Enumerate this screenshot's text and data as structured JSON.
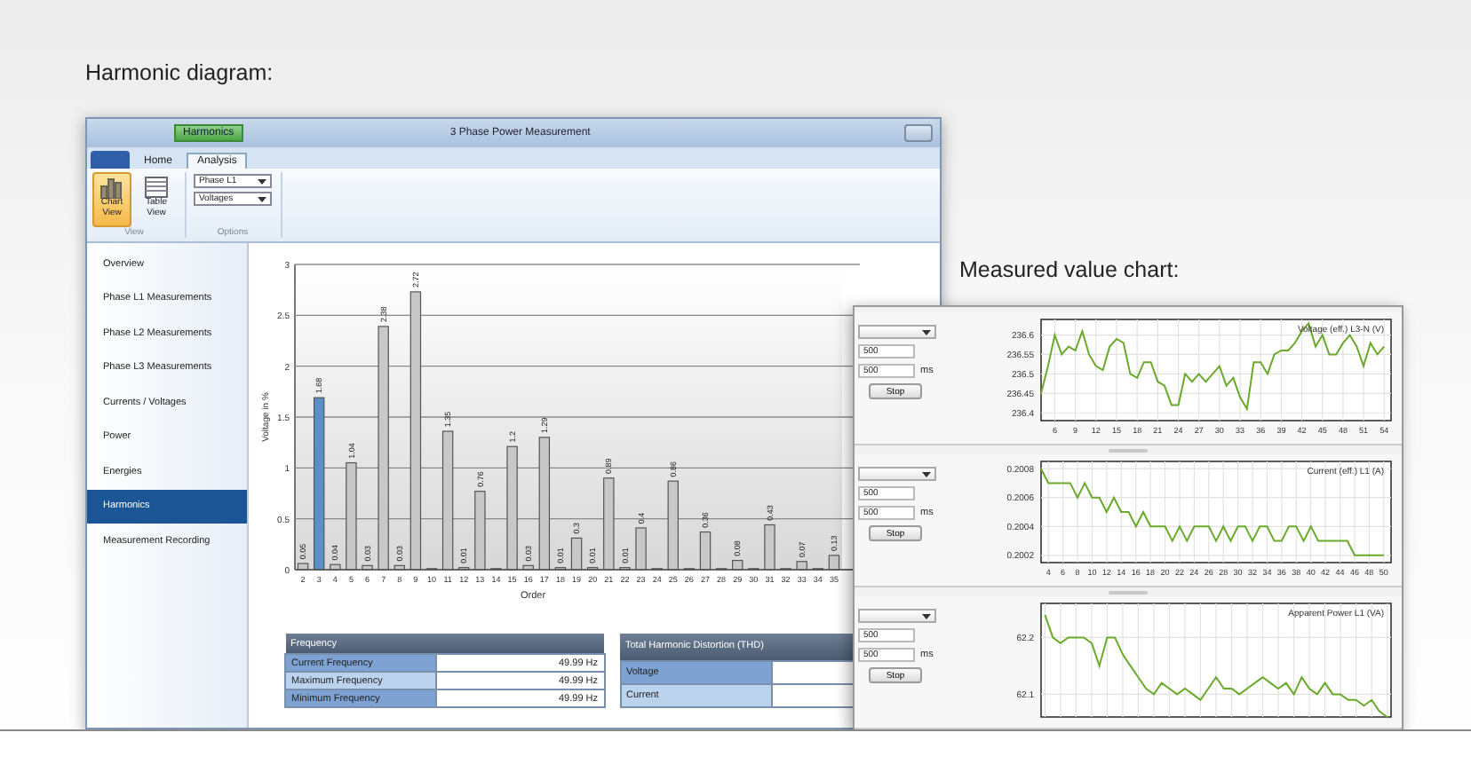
{
  "headings": [
    {
      "kind": "harmonic",
      "text": "Harmonic diagram:"
    },
    {
      "kind": "measured",
      "text": "Measured value chart:"
    }
  ],
  "harmonics_window": {
    "title_tab": "Harmonics",
    "title": "3 Phase Power Measurement",
    "ribbon_tabs": [
      {
        "label": "Home",
        "selected": false
      },
      {
        "label": "Analysis",
        "selected": true
      }
    ],
    "view_buttons": [
      {
        "kind": "chart",
        "label": "Chart View",
        "selected": true
      },
      {
        "kind": "table",
        "label": "Table View",
        "selected": false
      }
    ],
    "view_group": "View",
    "dropdowns": [
      "Phase L1",
      "Voltages"
    ],
    "options_group": "Options",
    "sidebar": {
      "items": [
        {
          "label": "Overview",
          "selected": false
        },
        {
          "label": "Phase L1 Measurements",
          "selected": false
        },
        {
          "label": "Phase L2 Measurements",
          "selected": false
        },
        {
          "label": "Phase L3 Measurements",
          "selected": false
        },
        {
          "label": "Currents / Voltages",
          "selected": false
        },
        {
          "label": "Power",
          "selected": false
        },
        {
          "label": "Energies",
          "selected": false
        },
        {
          "label": "Harmonics",
          "selected": true
        },
        {
          "label": "Measurement Recording",
          "selected": false
        }
      ]
    },
    "chart_data": {
      "type": "bar",
      "xlabel": "Order",
      "ylabel": "Voltage in %",
      "categories": [
        "2",
        "3",
        "4",
        "5",
        "6",
        "7",
        "8",
        "9",
        "10",
        "11",
        "12",
        "13",
        "14",
        "15",
        "16",
        "17",
        "18",
        "19",
        "20",
        "21",
        "22",
        "23",
        "24",
        "25",
        "26",
        "27",
        "28",
        "29",
        "30",
        "31",
        "32",
        "33",
        "34",
        "35"
      ],
      "values": [
        0.05,
        1.68,
        0.04,
        1.04,
        0.03,
        2.38,
        0.03,
        2.72,
        0,
        1.35,
        0.01,
        0.76,
        0,
        1.2,
        0.03,
        1.29,
        0.01,
        0.3,
        0.01,
        0.89,
        0.01,
        0.4,
        0,
        0.86,
        0,
        0.36,
        0,
        0.08,
        0,
        0.43,
        0,
        0.07,
        0,
        0.13
      ],
      "colors": [
        "#c8c8c8",
        "#5b8fc7",
        "#c8c8c8",
        "#c8c8c8",
        "#c8c8c8",
        "#c8c8c8",
        "#c8c8c8",
        "#c8c8c8",
        "#c8c8c8",
        "#c8c8c8",
        "#c8c8c8",
        "#c8c8c8",
        "#c8c8c8",
        "#c8c8c8",
        "#c8c8c8",
        "#c8c8c8",
        "#c8c8c8",
        "#c8c8c8",
        "#c8c8c8",
        "#c8c8c8",
        "#c8c8c8",
        "#c8c8c8",
        "#c8c8c8",
        "#c8c8c8",
        "#c8c8c8",
        "#c8c8c8",
        "#c8c8c8",
        "#c8c8c8",
        "#c8c8c8",
        "#c8c8c8",
        "#c8c8c8",
        "#c8c8c8",
        "#c8c8c8",
        "#c8c8c8"
      ],
      "ylim": [
        0,
        3
      ],
      "yticks": [
        0,
        {
          "value": 0.5,
          "label": "0.5"
        },
        {
          "value": 1,
          "label": "1"
        },
        {
          "value": 1.5,
          "label": "1.5"
        },
        {
          "value": 2,
          "label": "2"
        },
        {
          "value": 2.5,
          "label": "2.5"
        },
        {
          "value": 3,
          "label": "3"
        }
      ],
      "grid": true,
      "value_labels": [
        "0.05",
        "1.68",
        "0.04",
        "1.04",
        "0.03",
        "2.38",
        "0.03",
        "2.72",
        null,
        "1.35",
        "0.01",
        "0.76",
        null,
        "1.2",
        "0.03",
        "1.29",
        "0.01",
        "0.3",
        "0.01",
        "0.89",
        "0.01",
        "0.4",
        null,
        "0.86",
        null,
        "0.36",
        null,
        "0.08",
        null,
        "0.43",
        null,
        "0.07",
        null,
        "0.13"
      ]
    },
    "frequency_table": {
      "title": "Frequency",
      "rows": [
        {
          "label": "Current Frequency",
          "value": "49.99 Hz"
        },
        {
          "label": "Maximum Frequency",
          "value": "49.99 Hz"
        },
        {
          "label": "Minimum Frequency",
          "value": "49.99 Hz"
        }
      ]
    },
    "thd_table": {
      "title": "Total Harmonic Distortion (THD)",
      "rows": [
        {
          "label": "Voltage"
        },
        {
          "label": "Current"
        }
      ]
    }
  },
  "measured_window": {
    "panels": [
      {
        "inputs": [
          "500",
          "500"
        ],
        "unit": "ms",
        "button": "Stop",
        "chart_data": {
          "type": "line",
          "title": "Voltage (eff.) L3-N (V)",
          "xlim": [
            4,
            55
          ],
          "ylim": [
            236.38,
            236.64
          ],
          "xticks": [
            6,
            9,
            12,
            15,
            18,
            21,
            24,
            27,
            30,
            33,
            36,
            39,
            42,
            45,
            48,
            51,
            54
          ],
          "yticks": [
            236.4,
            236.45,
            236.5,
            236.55,
            236.6
          ],
          "x": [
            4,
            5,
            6,
            7,
            8,
            9,
            10,
            11,
            12,
            13,
            14,
            15,
            16,
            17,
            18,
            19,
            20,
            21,
            22,
            23,
            24,
            25,
            26,
            27,
            28,
            29,
            30,
            31,
            32,
            33,
            34,
            35,
            36,
            37,
            38,
            39,
            40,
            41,
            42,
            43,
            44,
            45,
            46,
            47,
            48,
            49,
            50,
            51,
            52,
            53,
            54
          ],
          "grid": true,
          "series": [
            {
              "color": "#6aaa2a",
              "values": [
                236.45,
                236.52,
                236.6,
                236.55,
                236.57,
                236.56,
                236.61,
                236.55,
                236.52,
                236.51,
                236.57,
                236.59,
                236.58,
                236.5,
                236.49,
                236.53,
                236.53,
                236.48,
                236.47,
                236.42,
                236.42,
                236.5,
                236.48,
                236.5,
                236.48,
                236.5,
                236.52,
                236.47,
                236.49,
                236.44,
                236.41,
                236.53,
                236.53,
                236.5,
                236.55,
                236.56,
                236.56,
                236.58,
                236.61,
                236.63,
                236.57,
                236.6,
                236.55,
                236.55,
                236.58,
                236.6,
                236.57,
                236.52,
                236.58,
                236.55,
                236.57
              ]
            }
          ]
        }
      },
      {
        "inputs": [
          "500",
          "500"
        ],
        "unit": "ms",
        "button": "Stop",
        "chart_data": {
          "type": "line",
          "title": "Current (eff.) L1 (A)",
          "xlim": [
            3,
            51
          ],
          "ylim": [
            0.20015,
            0.20085
          ],
          "xticks": [
            4,
            6,
            8,
            10,
            12,
            14,
            16,
            18,
            20,
            22,
            24,
            26,
            28,
            30,
            32,
            34,
            36,
            38,
            40,
            42,
            44,
            46,
            48,
            50
          ],
          "yticks": [
            0.2002,
            0.2004,
            0.2006,
            0.2008
          ],
          "x": [
            3,
            4,
            5,
            6,
            7,
            8,
            9,
            10,
            11,
            12,
            13,
            14,
            15,
            16,
            17,
            18,
            19,
            20,
            21,
            22,
            23,
            24,
            25,
            26,
            27,
            28,
            29,
            30,
            31,
            32,
            33,
            34,
            35,
            36,
            37,
            38,
            39,
            40,
            41,
            42,
            43,
            44,
            45,
            46,
            47,
            48,
            49,
            50
          ],
          "grid": true,
          "series": [
            {
              "color": "#6aaa2a",
              "values": [
                0.2008,
                0.2007,
                0.2007,
                0.2007,
                0.2007,
                0.2006,
                0.2007,
                0.2006,
                0.2006,
                0.2005,
                0.2006,
                0.2005,
                0.2005,
                0.2004,
                0.2005,
                0.2004,
                0.2004,
                0.2004,
                0.2003,
                0.2004,
                0.2003,
                0.2004,
                0.2004,
                0.2004,
                0.2003,
                0.2004,
                0.2003,
                0.2004,
                0.2004,
                0.2003,
                0.2004,
                0.2004,
                0.2003,
                0.2003,
                0.2004,
                0.2004,
                0.2003,
                0.2004,
                0.2003,
                0.2003,
                0.2003,
                0.2003,
                0.2003,
                0.2002,
                0.2002,
                0.2002,
                0.2002,
                0.2002
              ]
            }
          ]
        }
      },
      {
        "inputs": [
          "500",
          "500"
        ],
        "unit": "ms",
        "button": "Stop",
        "chart_data": {
          "type": "line",
          "title": "Apparent Power L1 (VA)",
          "ylim": [
            62.06,
            62.26
          ],
          "yticks": [
            62.1,
            62.2
          ],
          "grid": true,
          "series": [
            {
              "color": "#6aaa2a",
              "values": [
                62.24,
                62.2,
                62.19,
                62.2,
                62.2,
                62.2,
                62.19,
                62.15,
                62.2,
                62.2,
                62.17,
                62.15,
                62.13,
                62.11,
                62.1,
                62.12,
                62.11,
                62.1,
                62.11,
                62.1,
                62.09,
                62.11,
                62.13,
                62.11,
                62.11,
                62.1,
                62.11,
                62.12,
                62.13,
                62.12,
                62.11,
                62.12,
                62.1,
                62.13,
                62.11,
                62.1,
                62.12,
                62.1,
                62.1,
                62.09,
                62.09,
                62.08,
                62.09,
                62.07,
                62.06
              ]
            }
          ]
        }
      }
    ]
  }
}
